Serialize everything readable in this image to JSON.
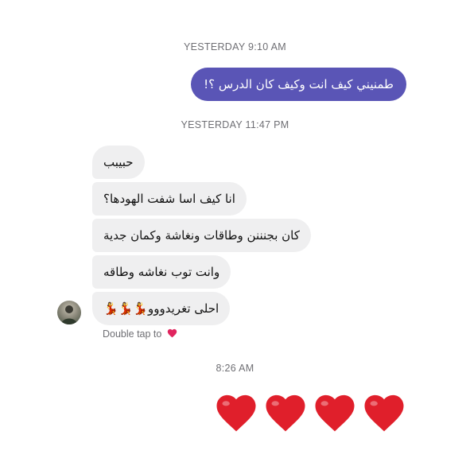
{
  "timestamps": {
    "first": "YESTERDAY 9:10 AM",
    "second": "YESTERDAY 11:47 PM",
    "third": "8:26 AM"
  },
  "outgoing_message": "طمنيني كيف انت وكيف كان الدرس ؟!",
  "incoming_messages": [
    "حبيبب",
    "انا كيف اسا شفت الهودها؟",
    "كان بجنننن وطاقات ونغاشة وكمان جدية",
    "وانت توب نغاشه وطاقه",
    "احلى تغريدووو💃💃💃"
  ],
  "double_tap": {
    "text": "Double tap to",
    "icon": "heart-icon",
    "color": "#e0245e"
  },
  "heart_reactions": {
    "count": 4,
    "icon": "heart-icon",
    "color": "#e01f2b"
  },
  "colors": {
    "outgoing_bubble": "#5a55b6",
    "incoming_bubble": "#efeff0",
    "timestamp_text": "#6f6f74"
  }
}
